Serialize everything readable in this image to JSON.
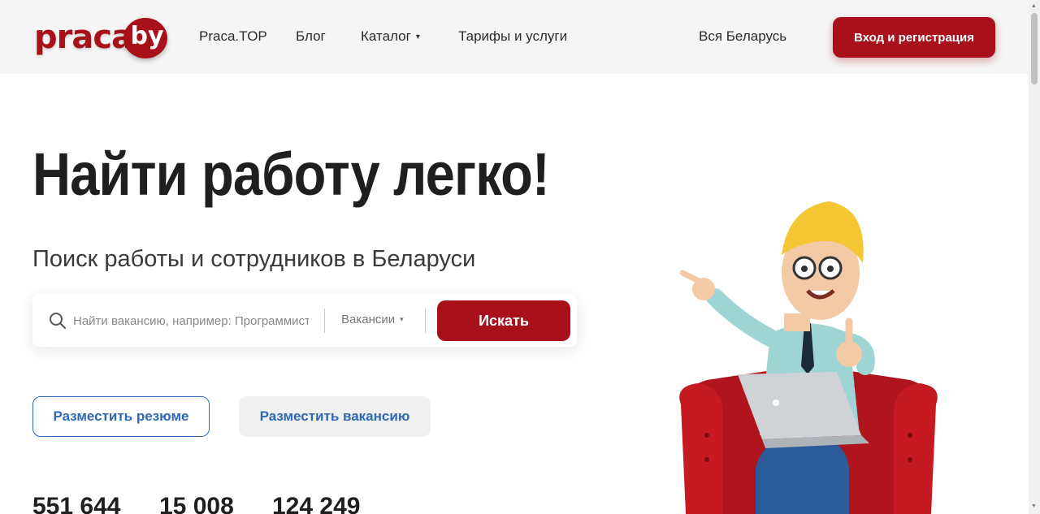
{
  "header": {
    "logo": {
      "text": "praca",
      "suffix": "by"
    },
    "nav": [
      {
        "label": "Praca.TOP"
      },
      {
        "label": "Блог"
      },
      {
        "label": "Каталог",
        "arrow": "▾"
      },
      {
        "label": "Тарифы и услуги"
      }
    ],
    "region": "Вся Беларусь",
    "login_label": "Вход и регистрация"
  },
  "hero": {
    "title": "Найти работу легко!",
    "subtitle": "Поиск работы и сотрудников в Беларуси"
  },
  "search": {
    "placeholder": "Найти вакансию, например: Программист",
    "value": "",
    "type_label": "Вакансии",
    "type_arrow": "▾",
    "button_label": "Искать",
    "icon": "search-icon"
  },
  "actions": {
    "resume_label": "Разместить резюме",
    "vacancy_label": "Разместить вакансию"
  },
  "stats": [
    {
      "value": "551 644"
    },
    {
      "value": "15 008"
    },
    {
      "value": "124 249"
    }
  ],
  "colors": {
    "brand": "#a8101a",
    "link": "#2d68b4",
    "header_bg": "#f5f5f5"
  }
}
